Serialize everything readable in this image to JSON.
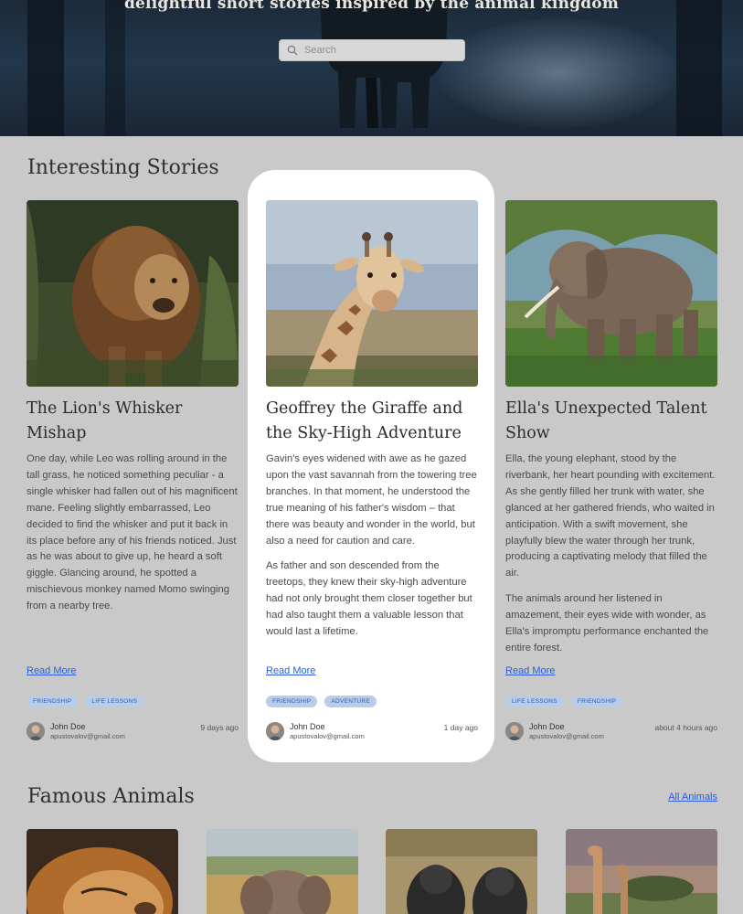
{
  "hero": {
    "tagline": "delightful short stories inspired by the animal kingdom",
    "search_placeholder": "Search"
  },
  "stories_section": {
    "title": "Interesting Stories"
  },
  "stories": [
    {
      "title": "The Lion's Whisker Mishap",
      "paragraphs": [
        "One day, while Leo was rolling around in the tall grass, he noticed something peculiar - a single whisker had fallen out of his magnificent mane. Feeling slightly embarrassed, Leo decided to find the whisker and put it back in its place before any of his friends noticed. Just as he was about to give up, he heard a soft giggle. Glancing around, he spotted a mischievous monkey named Momo swinging from a nearby tree."
      ],
      "read_more": "Read More",
      "tags": [
        "FRIENDSHIP",
        "LIFE LESSONS"
      ],
      "author": {
        "name": "John Doe",
        "email": "apustovalov@gmail.com"
      },
      "time": "9 days ago",
      "image": "lion-photo"
    },
    {
      "title": "Geoffrey the Giraffe and the Sky-High Adventure",
      "paragraphs": [
        "Gavin's eyes widened with awe as he gazed upon the vast savannah from the towering tree branches. In that moment, he understood the true meaning of his father's wisdom – that there was beauty and wonder in the world, but also a need for caution and care.",
        "As father and son descended from the treetops, they knew their sky-high adventure had not only brought them closer together but had also taught them a valuable lesson that would last a lifetime."
      ],
      "read_more": "Read More",
      "tags": [
        "FRIENDSHIP",
        "ADVENTURE"
      ],
      "author": {
        "name": "John Doe",
        "email": "apustovalov@gmail.com"
      },
      "time": "1 day ago",
      "image": "giraffe-photo"
    },
    {
      "title": "Ella's Unexpected Talent Show",
      "paragraphs": [
        "Ella, the young elephant, stood by the riverbank, her heart pounding with excitement. As she gently filled her trunk with water, she glanced at her gathered friends, who waited in anticipation. With a swift movement, she playfully blew the water through her trunk, producing a captivating melody that filled the air.",
        "The animals around her listened in amazement, their eyes wide with wonder, as Ella's impromptu performance enchanted the entire forest."
      ],
      "read_more": "Read More",
      "tags": [
        "LIFE LESSONS",
        "FRIENDSHIP"
      ],
      "author": {
        "name": "John Doe",
        "email": "apustovalov@gmail.com"
      },
      "time": "about 4 hours ago",
      "image": "elephant-photo"
    }
  ],
  "animals_section": {
    "title": "Famous Animals",
    "all_link": "All Animals"
  },
  "animals": [
    "lion-face-photo",
    "elephant-photo",
    "gorilla-photo",
    "giraffe-photo"
  ],
  "colors": {
    "link": "#2a5bd7",
    "tag_bg": "#b8cde8",
    "page_bg": "#c9c9c9"
  }
}
